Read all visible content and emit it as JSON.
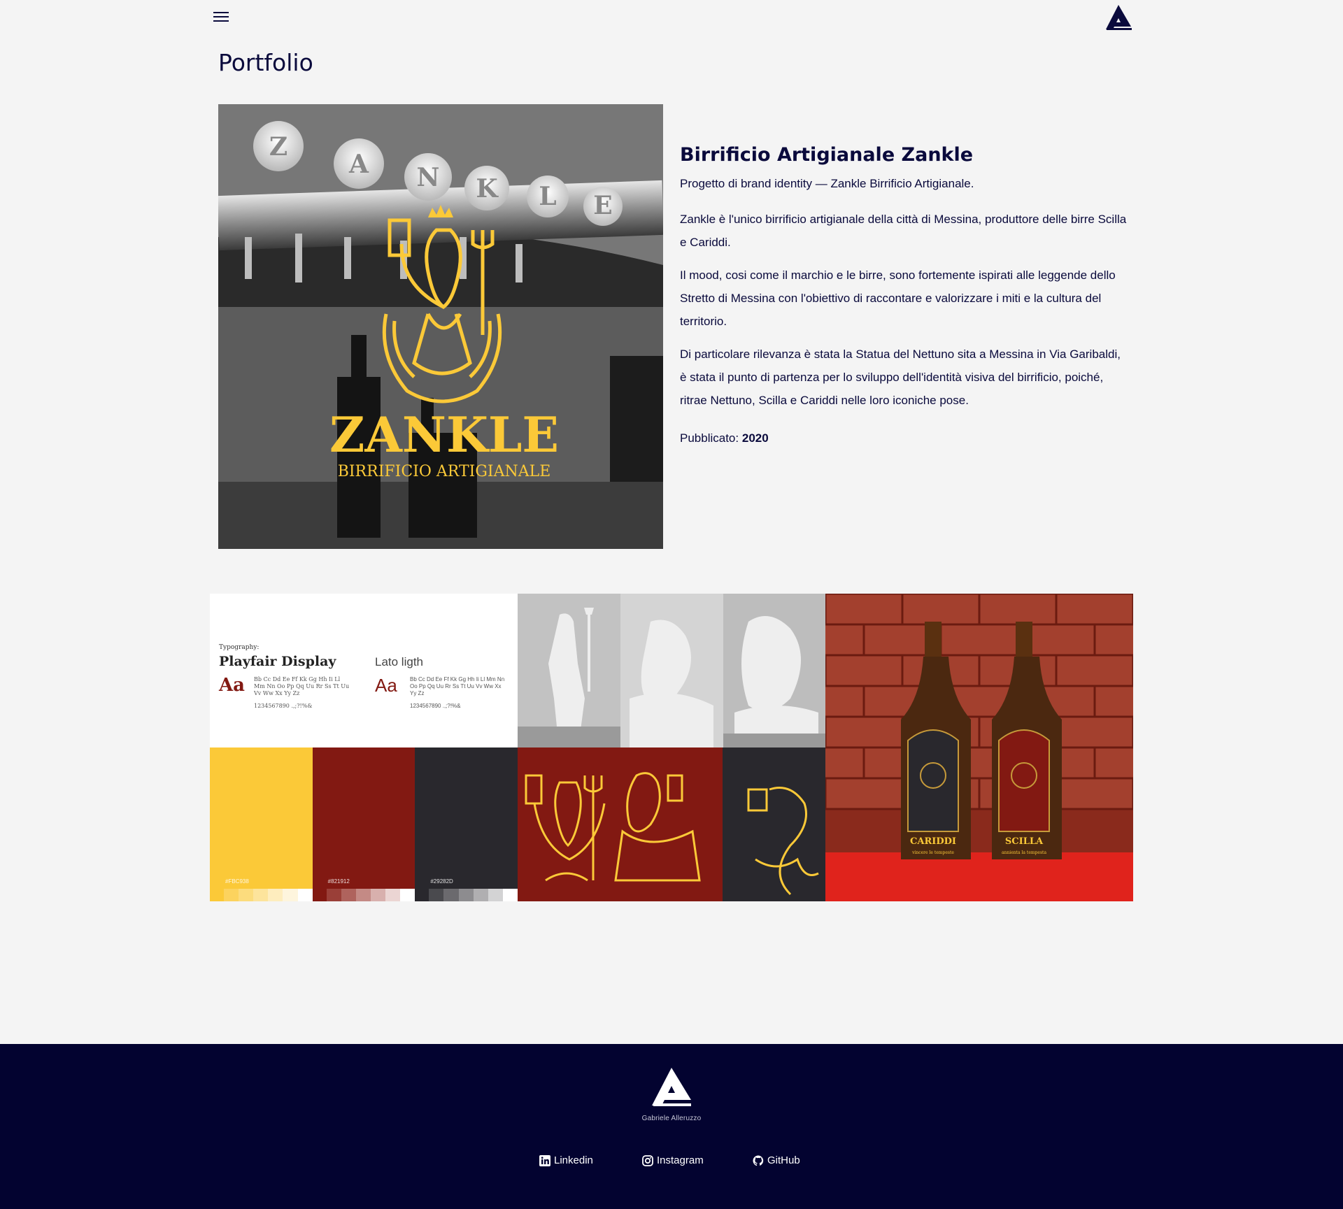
{
  "header": {
    "menu_icon": "hamburger-menu-icon",
    "logo_icon": "ag-monogram-logo-icon"
  },
  "page": {
    "title": "Portfolio"
  },
  "hero": {
    "sign_letters": [
      "Z",
      "A",
      "N",
      "K",
      "L",
      "E"
    ],
    "logo_wordmark": "ZANKLE",
    "logo_tagline": "BIRRIFICIO ARTIGIANALE",
    "logo_color": "#FBC938"
  },
  "project": {
    "title": "Birrificio Artigianale Zankle",
    "subtitle": "Progetto di brand identity — Zankle Birrificio Artigianale.",
    "paragraphs": [
      "Zankle è l'unico birrificio artigianale della città di Messina, produttore delle birre Scilla e Cariddi.",
      "Il mood, cosi come il marchio e le birre, sono fortemente ispirati alle leggende dello Stretto di Messina con l'obiettivo di raccontare e valorizzare i miti e la cultura del territorio.",
      "Di particolare rilevanza è stata la Statua del Nettuno sita a Messina in Via Garibaldi, è stata il punto di partenza per lo sviluppo dell'identità visiva del birrificio, poiché, ritrae Nettuno, Scilla e Cariddi nelle loro iconiche pose."
    ],
    "published_label": "Pubblicato:",
    "published_year": "2020"
  },
  "gallery": {
    "typography": {
      "caption": "Typography:",
      "font1_name": "Playfair Display",
      "font1_sample": "Aa",
      "font1_glyphs": "Bb Cc Dd Ee Ff Kk Gg Hh Ii Ll Mm Nn Oo Pp Qq Uu Rr Ss Tt Uu Vv Ww Xx Yy Zz",
      "font1_numbers": "1234567890 .,;?!%&",
      "font2_name": "Lato ligth",
      "font2_sample": "Aa",
      "font2_glyphs": "Bb Cc Dd Ee Ff Kk Gg Hh Ii Ll Mm Nn Oo Pp Qq Uu Rr Ss Tt Uu Vv Ww Xx Yy Zz",
      "font2_numbers": "1234567890 .,;?!%&"
    },
    "palette": [
      {
        "hex": "#FBC938",
        "color": "#FBC938",
        "shades": [
          "#fcd35e",
          "#fcdc7d",
          "#fde49c",
          "#feedbe",
          "#fef5dd",
          "#ffffff"
        ]
      },
      {
        "hex": "#821912",
        "color": "#821912",
        "shades": [
          "#9a3f38",
          "#af635d",
          "#c48a85",
          "#d8b0ad",
          "#ebd5d3",
          "#ffffff"
        ]
      },
      {
        "hex": "#29282D",
        "color": "#29282D",
        "shades": [
          "#4a4a4e",
          "#6b6a6e",
          "#8d8c8f",
          "#b0afb1",
          "#d3d3d4",
          "#ffffff"
        ]
      }
    ],
    "bottle_labels": [
      "CARIDDI",
      "SCILLA"
    ],
    "bottle_taglines": [
      "vincere le tempeste",
      "annienta la tempesta"
    ]
  },
  "footer": {
    "logo_icon": "ag-monogram-logo-icon",
    "name": "Gabriele Alleruzzo",
    "links": [
      {
        "label": "Linkedin",
        "icon": "linkedin-icon"
      },
      {
        "label": "Instagram",
        "icon": "instagram-icon"
      },
      {
        "label": "GitHub",
        "icon": "github-icon"
      }
    ]
  }
}
